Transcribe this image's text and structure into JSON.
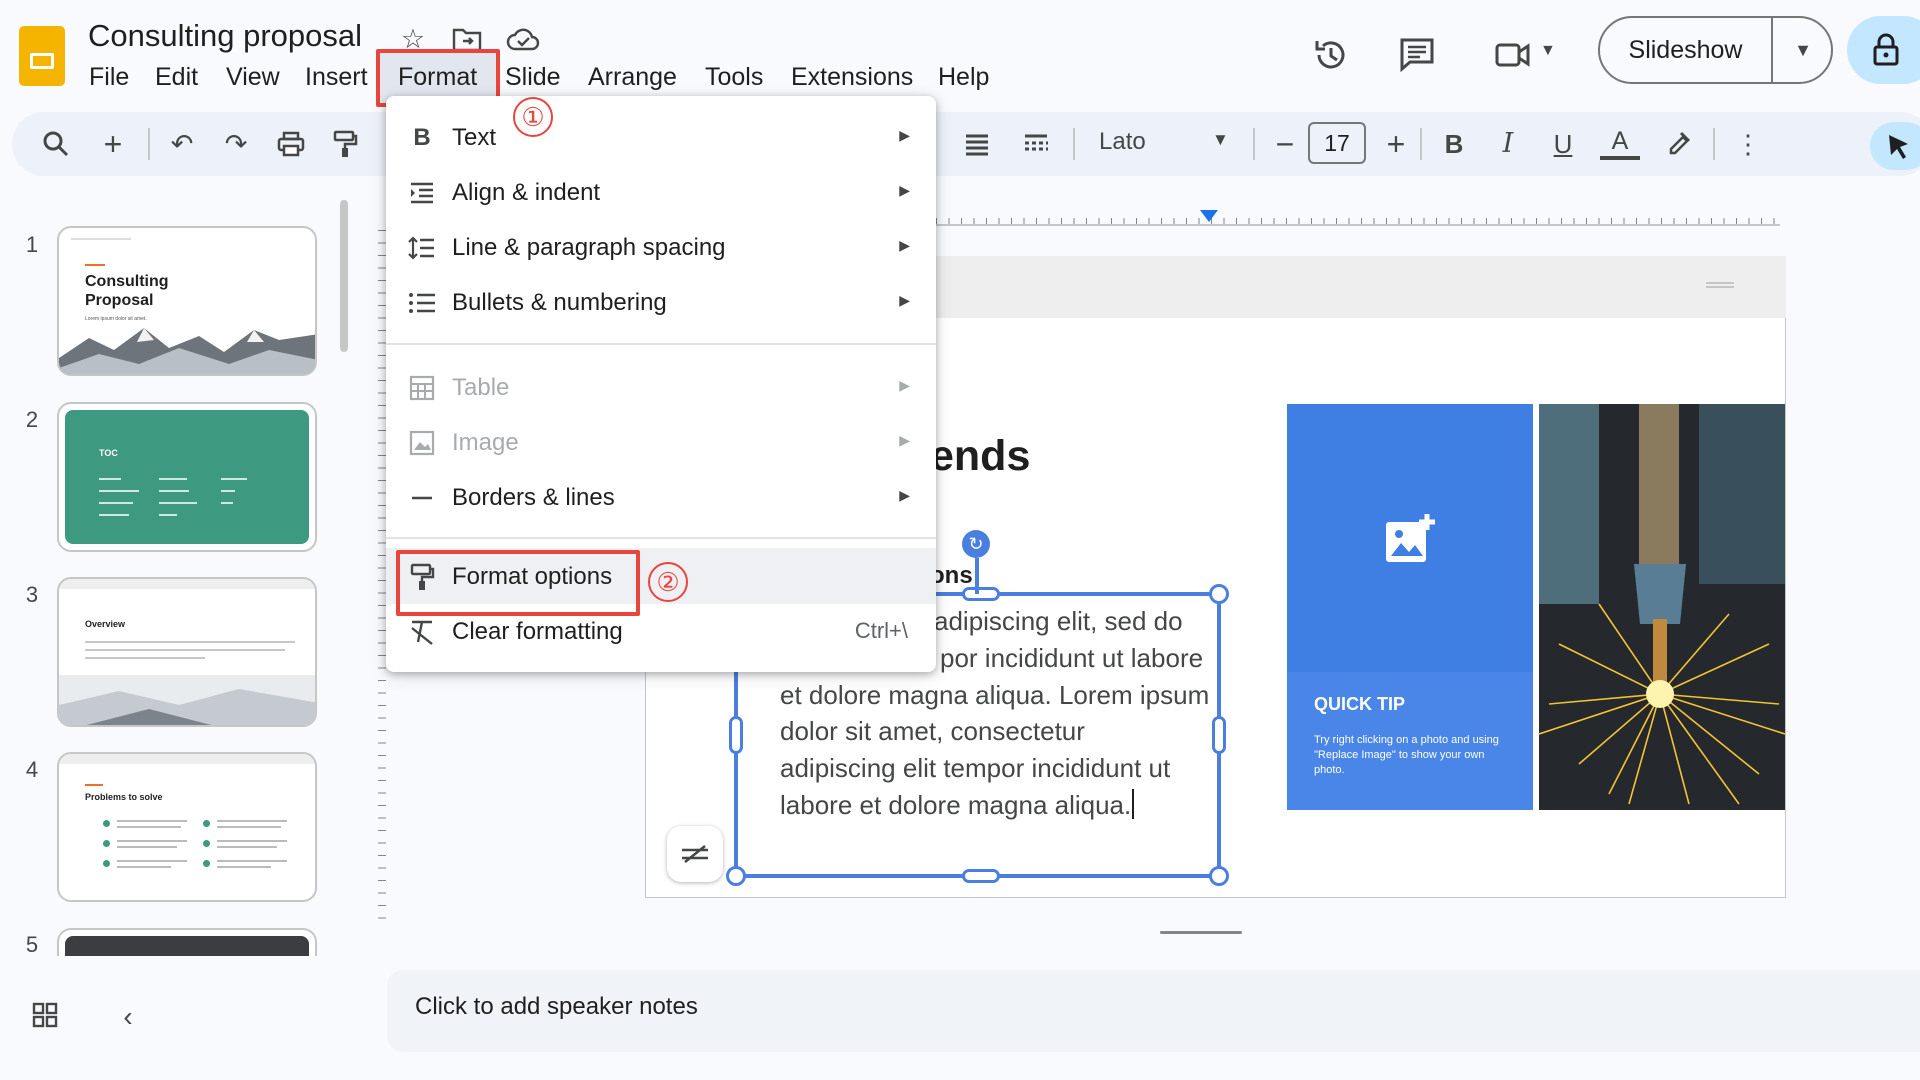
{
  "app": {
    "title": "Consulting proposal",
    "menus": [
      "File",
      "Edit",
      "View",
      "Insert",
      "Format",
      "Slide",
      "Arrange",
      "Tools",
      "Extensions",
      "Help"
    ],
    "slideshow_label": "Slideshow"
  },
  "toolbar": {
    "font_name": "Lato",
    "font_size": "17"
  },
  "filmstrip": {
    "slides": [
      {
        "number": "1",
        "title": "Consulting\nProposal",
        "subtitle": "Lorem ipsum dolor sit amet."
      },
      {
        "number": "2",
        "title": "TOC"
      },
      {
        "number": "3",
        "title": "Overview"
      },
      {
        "number": "4",
        "title": "Problems to solve"
      },
      {
        "number": "5"
      }
    ]
  },
  "slide": {
    "title_fragment": "ends",
    "subhead_fragment": "ons:",
    "body_lines": [
      "adipiscing elit, sed do",
      "por incididunt ut labore",
      "et dolore magna aliqua. Lorem ipsum",
      "dolor sit amet, consectetur",
      "adipiscing elit tempor incididunt ut",
      "labore et dolore magna aliqua."
    ],
    "tip_heading": "QUICK TIP",
    "tip_body": "Try right clicking on a photo and using \"Replace Image\" to show your own photo."
  },
  "notes": {
    "placeholder": "Click to add speaker notes"
  },
  "format_menu": {
    "items": [
      {
        "label": "Text",
        "icon": "bold-icon",
        "submenu": true,
        "enabled": true
      },
      {
        "label": "Align & indent",
        "icon": "align-indent-icon",
        "submenu": true,
        "enabled": true
      },
      {
        "label": "Line & paragraph spacing",
        "icon": "line-spacing-icon",
        "submenu": true,
        "enabled": true
      },
      {
        "label": "Bullets & numbering",
        "icon": "bulleted-list-icon",
        "submenu": true,
        "enabled": true
      },
      {
        "label": "Table",
        "icon": "table-icon",
        "submenu": true,
        "enabled": false
      },
      {
        "label": "Image",
        "icon": "image-icon",
        "submenu": true,
        "enabled": false
      },
      {
        "label": "Borders & lines",
        "icon": "border-line-icon",
        "submenu": true,
        "enabled": true
      },
      {
        "label": "Format options",
        "icon": "format-options-icon",
        "submenu": false,
        "enabled": true
      },
      {
        "label": "Clear formatting",
        "icon": "clear-formatting-icon",
        "shortcut": "Ctrl+\\",
        "enabled": true
      }
    ]
  },
  "annotations": {
    "step1": "①",
    "step2": "②",
    "highlight_color": "#e8453c"
  },
  "colors": {
    "accent": "#1a73e8",
    "selection": "#4a7fe0",
    "tip_panel": "#4a86e8",
    "slide2_bg": "#3d9a80",
    "logo": "#f4b400"
  }
}
